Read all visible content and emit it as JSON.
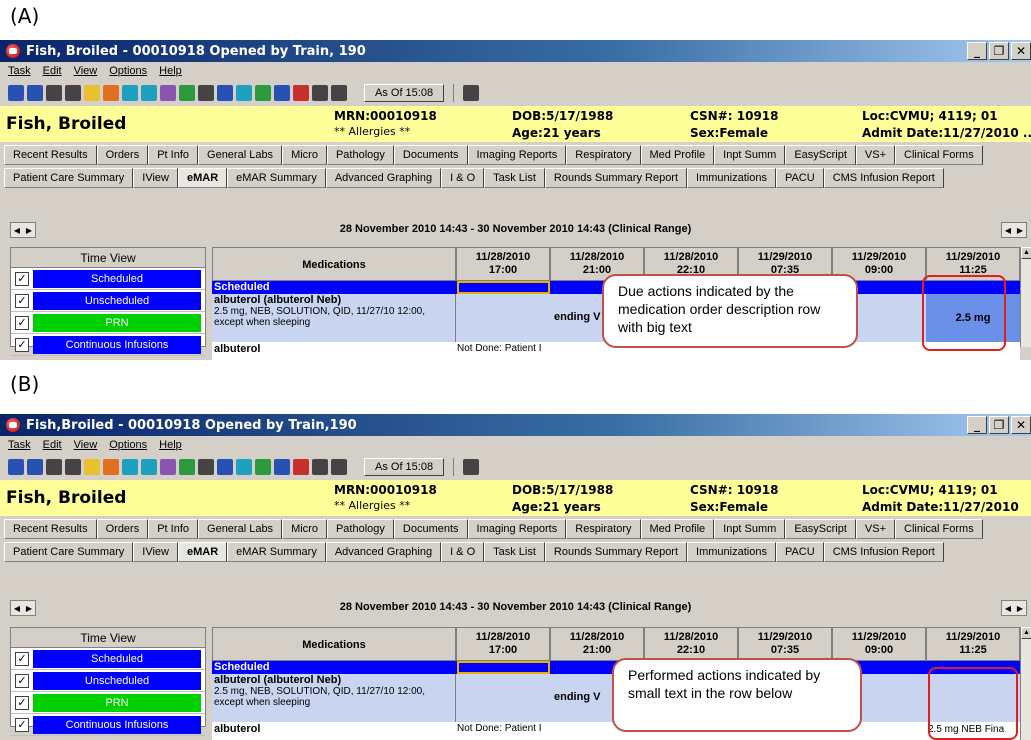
{
  "panels": [
    {
      "label": "(A)",
      "window_title": "Fish, Broiled - 00010918 Opened by Train, 190",
      "callout_text": "Due actions indicated by the medication order description row with big text",
      "big_dose": "2.5 mg",
      "small_dose": "",
      "admit": "Admit Date:11/27/2010 .."
    },
    {
      "label": "(B)",
      "window_title": "Fish,Broiled - 00010918 Opened by Train,190",
      "callout_text": "Performed actions indicated by small text in the row below",
      "big_dose": "",
      "small_dose": "2.5 mg NEB Fina",
      "admit": "Admit Date:11/27/2010"
    }
  ],
  "window_buttons": [
    "_",
    "̅",
    "X"
  ],
  "menu": [
    "Task",
    "Edit",
    "View",
    "Options",
    "Help"
  ],
  "toolbar": {
    "as_of": "As Of 15:08"
  },
  "patient": {
    "name": "Fish, Broiled",
    "mrn": "MRN:00010918",
    "allergies": "** Allergies **",
    "dob": "DOB:5/17/1988",
    "age": "Age:21 years",
    "csn": "CSN#: 10918",
    "sex": "Sex:Female",
    "loc": "Loc:CVMU; 4119; 01"
  },
  "tabs_row1": [
    "Recent Results",
    "Orders",
    "Pt Info",
    "General Labs",
    "Micro",
    "Pathology",
    "Documents",
    "Imaging Reports",
    "Respiratory",
    "Med Profile",
    "Inpt Summ",
    "EasyScript",
    "VS+",
    "Clinical Forms"
  ],
  "tabs_row2": [
    "Patient Care Summary",
    "IView",
    "eMAR",
    "eMAR Summary",
    "Advanced Graphing",
    "I & O",
    "Task List",
    "Rounds Summary Report",
    "Immunizations",
    "PACU",
    "CMS Infusion Report"
  ],
  "active_tab": "eMAR",
  "range_text": "28 November 2010 14:43 - 30 November 2010 14:43 (Clinical Range)",
  "time_view": {
    "header": "Time View",
    "items": [
      "Scheduled",
      "Unscheduled",
      "PRN",
      "Continuous Infusions"
    ]
  },
  "grid": {
    "med_header": "Medications",
    "columns": [
      {
        "date": "11/28/2010",
        "time": "17:00"
      },
      {
        "date": "11/28/2010",
        "time": "21:00"
      },
      {
        "date": "11/28/2010",
        "time": "22:10"
      },
      {
        "date": "11/29/2010",
        "time": "07:35"
      },
      {
        "date": "11/29/2010",
        "time": "09:00"
      },
      {
        "date": "11/29/2010",
        "time": "11:25"
      }
    ],
    "section": "Scheduled",
    "med_title": "albuterol (albuterol Neb)",
    "med_desc": "2.5 mg, NEB, SOLUTION, QID, 11/27/10 12:00, except when sleeping",
    "pending": "ending V",
    "row2_label": "albuterol",
    "not_done": "Not Done: Patient I"
  }
}
